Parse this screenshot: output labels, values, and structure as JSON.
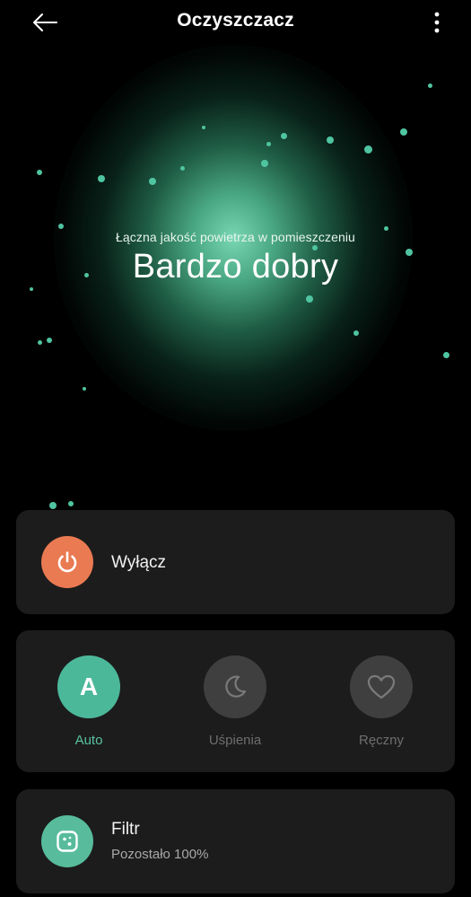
{
  "header": {
    "title": "Oczyszczacz",
    "back_icon": "arrow-left-icon",
    "more_icon": "more-vertical-icon"
  },
  "air_quality": {
    "caption": "Łączna jakość powietrza w pomieszczeniu",
    "value": "Bardzo dobry",
    "accent_color": "#4fc4a0"
  },
  "power": {
    "label": "Wyłącz",
    "icon": "power-icon",
    "color": "#ea7a52"
  },
  "modes": {
    "items": [
      {
        "label": "Auto",
        "icon_text": "A",
        "active": true
      },
      {
        "label": "Uśpienia",
        "icon": "moon-icon",
        "active": false
      },
      {
        "label": "Ręczny",
        "icon": "heart-icon",
        "active": false
      }
    ],
    "active_color": "#57c4a2",
    "inactive_color": "#6e6e6e"
  },
  "filter": {
    "label": "Filtr",
    "remaining_text": "Pozostało 100%",
    "remaining_percent": 100,
    "icon": "filter-icon",
    "color": "#58bc9c"
  }
}
